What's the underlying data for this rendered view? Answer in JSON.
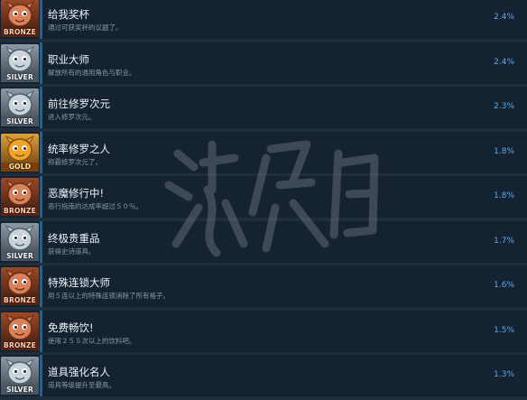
{
  "achievements": [
    {
      "title": "给我奖杯",
      "desc": "通过可获奖杯的议题了。",
      "pct": "2.4%",
      "tier": "bronze",
      "tier_label": "BRONZE",
      "icon": "bronze-trophy-icon"
    },
    {
      "title": "职业大师",
      "desc": "解放所有的通用角色与职业。",
      "pct": "2.4%",
      "tier": "silver",
      "tier_label": "SILVER",
      "icon": "silver-trophy-icon"
    },
    {
      "title": "前往修罗次元",
      "desc": "进入修罗次元。",
      "pct": "2.3%",
      "tier": "silver",
      "tier_label": "SILVER",
      "icon": "silver-trophy-icon"
    },
    {
      "title": "统率修罗之人",
      "desc": "称霸修罗次元了。",
      "pct": "1.8%",
      "tier": "gold",
      "tier_label": "GOLD",
      "icon": "gold-trophy-icon"
    },
    {
      "title": "恶魔修行中!",
      "desc": "恶行指南的达成率超过５０％。",
      "pct": "1.8%",
      "tier": "bronze",
      "tier_label": "BRONZE",
      "icon": "bronze-trophy-icon"
    },
    {
      "title": "终极贵重品",
      "desc": "获得史诗道具。",
      "pct": "1.7%",
      "tier": "silver",
      "tier_label": "SILVER",
      "icon": "silver-trophy-icon"
    },
    {
      "title": "特殊连锁大师",
      "desc": "用５连以上的特殊连锁消除了所有格子。",
      "pct": "1.6%",
      "tier": "bronze",
      "tier_label": "BRONZE",
      "icon": "bronze-trophy-icon"
    },
    {
      "title": "免费畅饮!",
      "desc": "使用２５５次以上的饮料吧。",
      "pct": "1.5%",
      "tier": "bronze",
      "tier_label": "BRONZE",
      "icon": "bronze-trophy-icon"
    },
    {
      "title": "道具强化名人",
      "desc": "道具等级提升至最高。",
      "pct": "1.3%",
      "tier": "silver",
      "tier_label": "SILVER",
      "icon": "silver-trophy-icon"
    }
  ],
  "colors": {
    "background": "#1b2838",
    "row": "#152231",
    "percent": "#62a7e3",
    "title": "#eef3f7",
    "desc": "#8b98a5"
  }
}
